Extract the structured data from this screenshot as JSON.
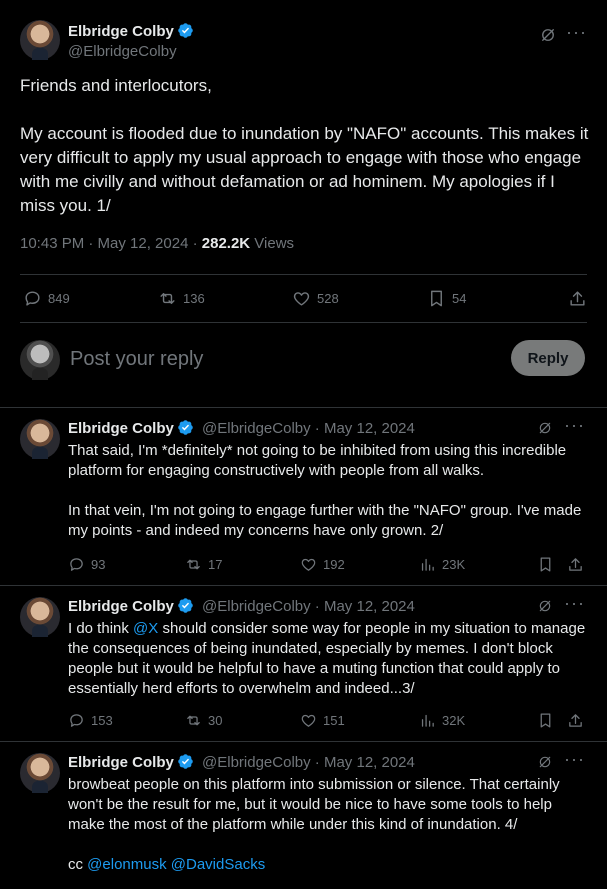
{
  "main_tweet": {
    "author_name": "Elbridge Colby",
    "author_handle": "@ElbridgeColby",
    "text": "Friends and interlocutors,\n\nMy account is flooded due to inundation by \"NAFO\" accounts. This makes it very difficult to apply my usual approach to engage with those who engage with me civilly and without defamation or ad hominem. My apologies if I miss you. 1/",
    "timestamp": "10:43 PM · May 12, 2024 · ",
    "views_count": "282.2K",
    "views_label": " Views",
    "replies": "849",
    "reposts": "136",
    "likes": "528",
    "bookmarks": "54"
  },
  "reply_box": {
    "placeholder": "Post your reply",
    "button_label": "Reply"
  },
  "thread": [
    {
      "author_name": "Elbridge Colby",
      "author_handle": "@ElbridgeColby",
      "date": " · May 12, 2024",
      "text": "That said, I'm *definitely* not going to be inhibited from using this incredible platform for engaging constructively with people from all walks.\n\nIn that vein, I'm not going to engage further with the \"NAFO\" group. I've made my points - and indeed my concerns have only grown. 2/",
      "replies": "93",
      "reposts": "17",
      "likes": "192",
      "views": "23K"
    },
    {
      "author_name": "Elbridge Colby",
      "author_handle": "@ElbridgeColby",
      "date": " · May 12, 2024",
      "text_before_mention": "I do think ",
      "mention": "@X",
      "text_after_mention": " should consider some way for people in my situation to manage the consequences of being inundated, especially by memes. I don't block people but it would be helpful to have a muting function that could apply to essentially herd efforts to overwhelm and indeed...3/",
      "replies": "153",
      "reposts": "30",
      "likes": "151",
      "views": "32K"
    },
    {
      "author_name": "Elbridge Colby",
      "author_handle": "@ElbridgeColby",
      "date": " · May 12, 2024",
      "text": "browbeat people on this platform into submission or silence. That certainly won't be the result for me, but it would be nice to have some tools to help make the most of the platform while under this kind of inundation. 4/",
      "cc_label": "cc ",
      "mention_1": "@elonmusk",
      "mention_2": "@DavidSacks"
    }
  ],
  "colors": {
    "background": "#000000",
    "text": "#e7e9ea",
    "muted": "#71767b",
    "link": "#1d9bf0",
    "verified": "#1d9bf0",
    "divider": "#2f3336"
  }
}
